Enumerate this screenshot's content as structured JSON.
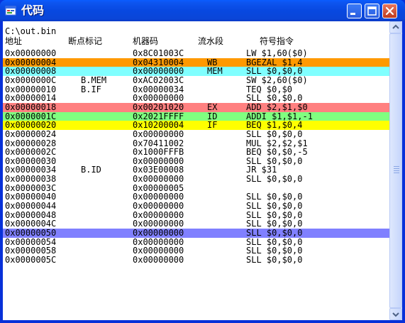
{
  "window": {
    "title": "代码",
    "file_label": "C:\\out.bin"
  },
  "columns": {
    "address": "地址",
    "breakpoint": "断点标记",
    "machine_code": "机器码",
    "pipeline": "流水段",
    "instruction": "符号指令"
  },
  "colors": {
    "WB": "#ff9900",
    "MEM": "#80ffff",
    "EX": "#ff8080",
    "ID": "#80ff80",
    "IF": "#ffff00",
    "selected": "#8080ff"
  },
  "rows": [
    {
      "addr": "0x00000000",
      "bp": "",
      "code": "0x8C01003C",
      "stage": "",
      "instr": "LW $1,60($0)",
      "hl": ""
    },
    {
      "addr": "0x00000004",
      "bp": "",
      "code": "0x04310004",
      "stage": "WB",
      "instr": "BGEZAL $1,4",
      "hl": "WB"
    },
    {
      "addr": "0x00000008",
      "bp": "",
      "code": "0x00000000",
      "stage": "MEM",
      "instr": "SLL $0,$0,0",
      "hl": "MEM"
    },
    {
      "addr": "0x0000000C",
      "bp": "B.MEM",
      "code": "0xAC02003C",
      "stage": "",
      "instr": "SW $2,60($0)",
      "hl": ""
    },
    {
      "addr": "0x00000010",
      "bp": "B.IF",
      "code": "0x00000034",
      "stage": "",
      "instr": "TEQ $0,$0",
      "hl": ""
    },
    {
      "addr": "0x00000014",
      "bp": "",
      "code": "0x00000000",
      "stage": "",
      "instr": "SLL $0,$0,0",
      "hl": ""
    },
    {
      "addr": "0x00000018",
      "bp": "",
      "code": "0x00201020",
      "stage": "EX",
      "instr": "ADD $2,$1,$0",
      "hl": "EX"
    },
    {
      "addr": "0x0000001C",
      "bp": "",
      "code": "0x2021FFFF",
      "stage": "ID",
      "instr": "ADDI $1,$1,-1",
      "hl": "ID"
    },
    {
      "addr": "0x00000020",
      "bp": "",
      "code": "0x10200004",
      "stage": "IF",
      "instr": "BEQ $1,$0,4",
      "hl": "IF"
    },
    {
      "addr": "0x00000024",
      "bp": "",
      "code": "0x00000000",
      "stage": "",
      "instr": "SLL $0,$0,0",
      "hl": ""
    },
    {
      "addr": "0x00000028",
      "bp": "",
      "code": "0x70411002",
      "stage": "",
      "instr": "MUL $2,$2,$1",
      "hl": ""
    },
    {
      "addr": "0x0000002C",
      "bp": "",
      "code": "0x1000FFFB",
      "stage": "",
      "instr": "BEQ $0,$0,-5",
      "hl": ""
    },
    {
      "addr": "0x00000030",
      "bp": "",
      "code": "0x00000000",
      "stage": "",
      "instr": "SLL $0,$0,0",
      "hl": ""
    },
    {
      "addr": "0x00000034",
      "bp": "B.ID",
      "code": "0x03E00008",
      "stage": "",
      "instr": "JR $31",
      "hl": ""
    },
    {
      "addr": "0x00000038",
      "bp": "",
      "code": "0x00000000",
      "stage": "",
      "instr": "SLL $0,$0,0",
      "hl": ""
    },
    {
      "addr": "0x0000003C",
      "bp": "",
      "code": "0x00000005",
      "stage": "",
      "instr": "",
      "hl": ""
    },
    {
      "addr": "0x00000040",
      "bp": "",
      "code": "0x00000000",
      "stage": "",
      "instr": "SLL $0,$0,0",
      "hl": ""
    },
    {
      "addr": "0x00000044",
      "bp": "",
      "code": "0x00000000",
      "stage": "",
      "instr": "SLL $0,$0,0",
      "hl": ""
    },
    {
      "addr": "0x00000048",
      "bp": "",
      "code": "0x00000000",
      "stage": "",
      "instr": "SLL $0,$0,0",
      "hl": ""
    },
    {
      "addr": "0x0000004C",
      "bp": "",
      "code": "0x00000000",
      "stage": "",
      "instr": "SLL $0,$0,0",
      "hl": ""
    },
    {
      "addr": "0x00000050",
      "bp": "",
      "code": "0x00000000",
      "stage": "",
      "instr": "SLL $0,$0,0",
      "hl": "selected"
    },
    {
      "addr": "0x00000054",
      "bp": "",
      "code": "0x00000000",
      "stage": "",
      "instr": "SLL $0,$0,0",
      "hl": ""
    },
    {
      "addr": "0x00000058",
      "bp": "",
      "code": "0x00000000",
      "stage": "",
      "instr": "SLL $0,$0,0",
      "hl": ""
    },
    {
      "addr": "0x0000005C",
      "bp": "",
      "code": "0x00000000",
      "stage": "",
      "instr": "SLL $0,$0,0",
      "hl": ""
    }
  ]
}
